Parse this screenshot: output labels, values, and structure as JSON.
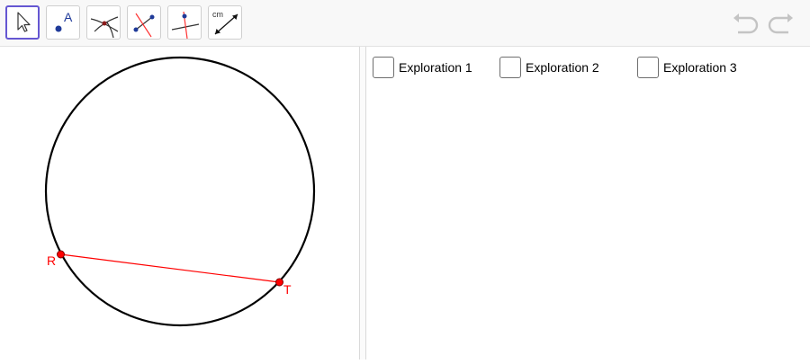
{
  "toolbar": {
    "tools": [
      {
        "name": "move-tool",
        "label": "",
        "selected": true
      },
      {
        "name": "point-tool",
        "label": "A",
        "selected": false
      },
      {
        "name": "intersect-tool",
        "label": "",
        "selected": false
      },
      {
        "name": "midpoint-tool",
        "label": "",
        "selected": false
      },
      {
        "name": "perpendicular-bisector-tool",
        "label": "",
        "selected": false
      },
      {
        "name": "distance-tool",
        "label": "cm",
        "selected": false
      }
    ],
    "undo_icon": "undo-icon",
    "redo_icon": "redo-icon"
  },
  "graphics": {
    "circle_color": "#000000",
    "segment_color": "#ff0000",
    "points": [
      {
        "label": "R",
        "color": "#ff0000"
      },
      {
        "label": "T",
        "color": "#ff0000"
      }
    ]
  },
  "exploration": {
    "checkboxes": [
      {
        "label": "Exploration 1",
        "checked": false
      },
      {
        "label": "Exploration 2",
        "checked": false
      },
      {
        "label": "Exploration 3",
        "checked": false
      }
    ]
  },
  "colors": {
    "selected_tool_border": "#6557d2",
    "toolbar_bg": "#f8f8f8",
    "point_fill": "#ff0000",
    "point_label": "#ff0000"
  }
}
